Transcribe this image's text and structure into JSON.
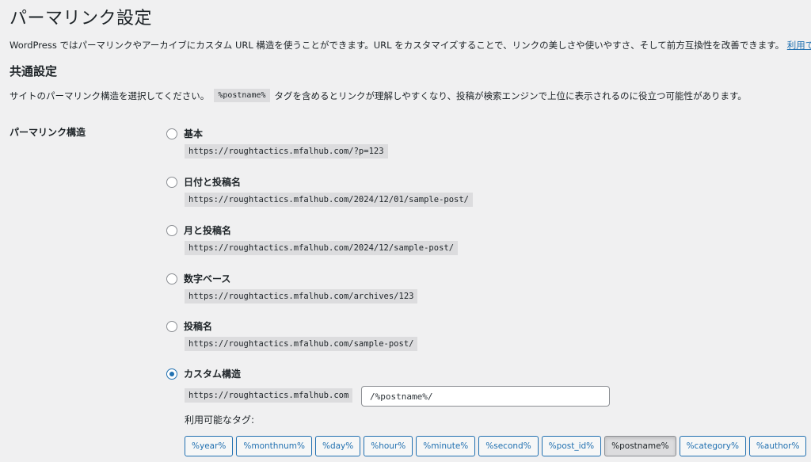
{
  "page": {
    "title": "パーマリンク設定",
    "intro": "WordPress ではパーマリンクやアーカイブにカスタム URL 構造を使うことができます。URL をカスタマイズすることで、リンクの美しさや使いやすさ、そして前方互換性を改善できます。",
    "intro_link": "利用で"
  },
  "common": {
    "title": "共通設定",
    "desc_before": "サイトのパーマリンク構造を選択してください。",
    "desc_code": "%postname%",
    "desc_after": "タグを含めるとリンクが理解しやすくなり、投稿が検索エンジンで上位に表示されるのに役立つ可能性があります。"
  },
  "structure": {
    "label": "パーマリンク構造",
    "options": [
      {
        "label": "基本",
        "url": "https://roughtactics.mfalhub.com/?p=123",
        "checked": false
      },
      {
        "label": "日付と投稿名",
        "url": "https://roughtactics.mfalhub.com/2024/12/01/sample-post/",
        "checked": false
      },
      {
        "label": "月と投稿名",
        "url": "https://roughtactics.mfalhub.com/2024/12/sample-post/",
        "checked": false
      },
      {
        "label": "数字ベース",
        "url": "https://roughtactics.mfalhub.com/archives/123",
        "checked": false
      },
      {
        "label": "投稿名",
        "url": "https://roughtactics.mfalhub.com/sample-post/",
        "checked": false
      }
    ],
    "custom": {
      "label": "カスタム構造",
      "base": "https://roughtactics.mfalhub.com",
      "value": "/%postname%/",
      "checked": true
    },
    "tags_label": "利用可能なタグ:",
    "tags": [
      "%year%",
      "%monthnum%",
      "%day%",
      "%hour%",
      "%minute%",
      "%second%",
      "%post_id%",
      "%postname%",
      "%category%",
      "%author%"
    ],
    "active_tag": "%postname%"
  },
  "colors": {
    "background": "#f0f0f1",
    "accent": "#2271b1",
    "code_bg": "#dcdcde"
  }
}
